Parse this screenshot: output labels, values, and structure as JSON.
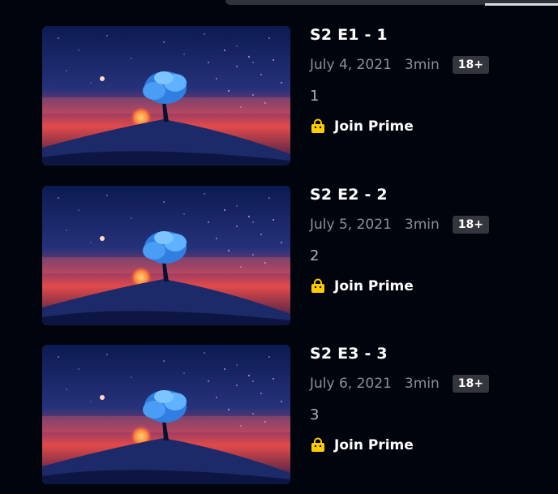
{
  "episodes": [
    {
      "title": "S2 E1 - 1",
      "date": "July 4, 2021",
      "duration": "3min",
      "rating": "18+",
      "synopsis": "1",
      "cta": "Join Prime",
      "cta_icon": "shopping-bag-icon"
    },
    {
      "title": "S2 E2 - 2",
      "date": "July 5, 2021",
      "duration": "3min",
      "rating": "18+",
      "synopsis": "2",
      "cta": "Join Prime",
      "cta_icon": "shopping-bag-icon"
    },
    {
      "title": "S2 E3 - 3",
      "date": "July 6, 2021",
      "duration": "3min",
      "rating": "18+",
      "synopsis": "3",
      "cta": "Join Prime",
      "cta_icon": "shopping-bag-icon"
    }
  ],
  "colors": {
    "background": "#00050d",
    "cta_icon": "#ffcc00",
    "meta_text": "#8d9196",
    "rating_badge": "#33373d"
  }
}
